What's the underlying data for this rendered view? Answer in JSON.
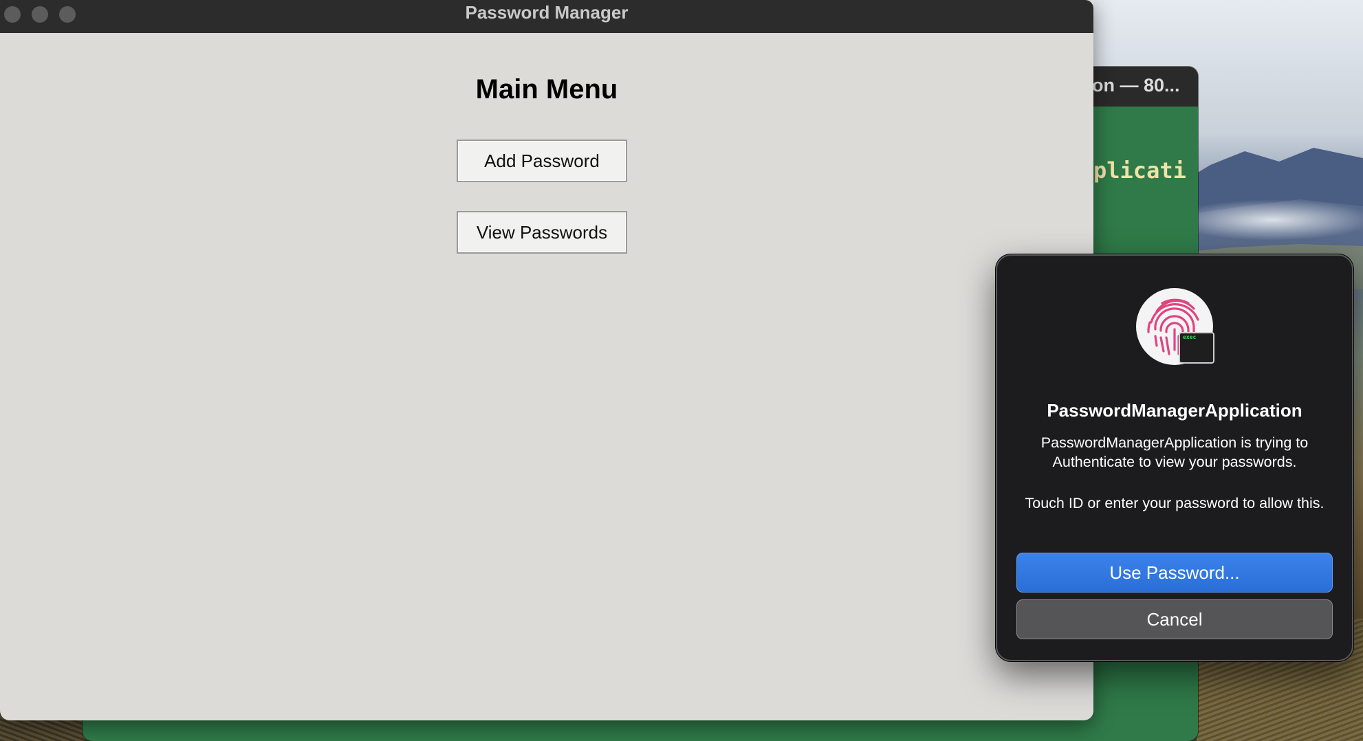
{
  "app_window": {
    "title": "Password Manager",
    "heading": "Main Menu",
    "buttons": {
      "add_password": "Add Password",
      "view_passwords": "View Passwords"
    }
  },
  "terminal_window": {
    "title_fragment": "on — 80...",
    "text_fragment": "plicati",
    "background_color": "#2f7a48"
  },
  "auth_dialog": {
    "icon": "touch-id-fingerprint-icon",
    "badge_text": "exec",
    "app_name": "PasswordManagerApplication",
    "message": "PasswordManagerApplication is trying to Authenticate to view your passwords.",
    "hint": "Touch ID or enter your password to allow this.",
    "use_password_label": "Use Password...",
    "cancel_label": "Cancel",
    "accent_color": "#2f74de"
  }
}
